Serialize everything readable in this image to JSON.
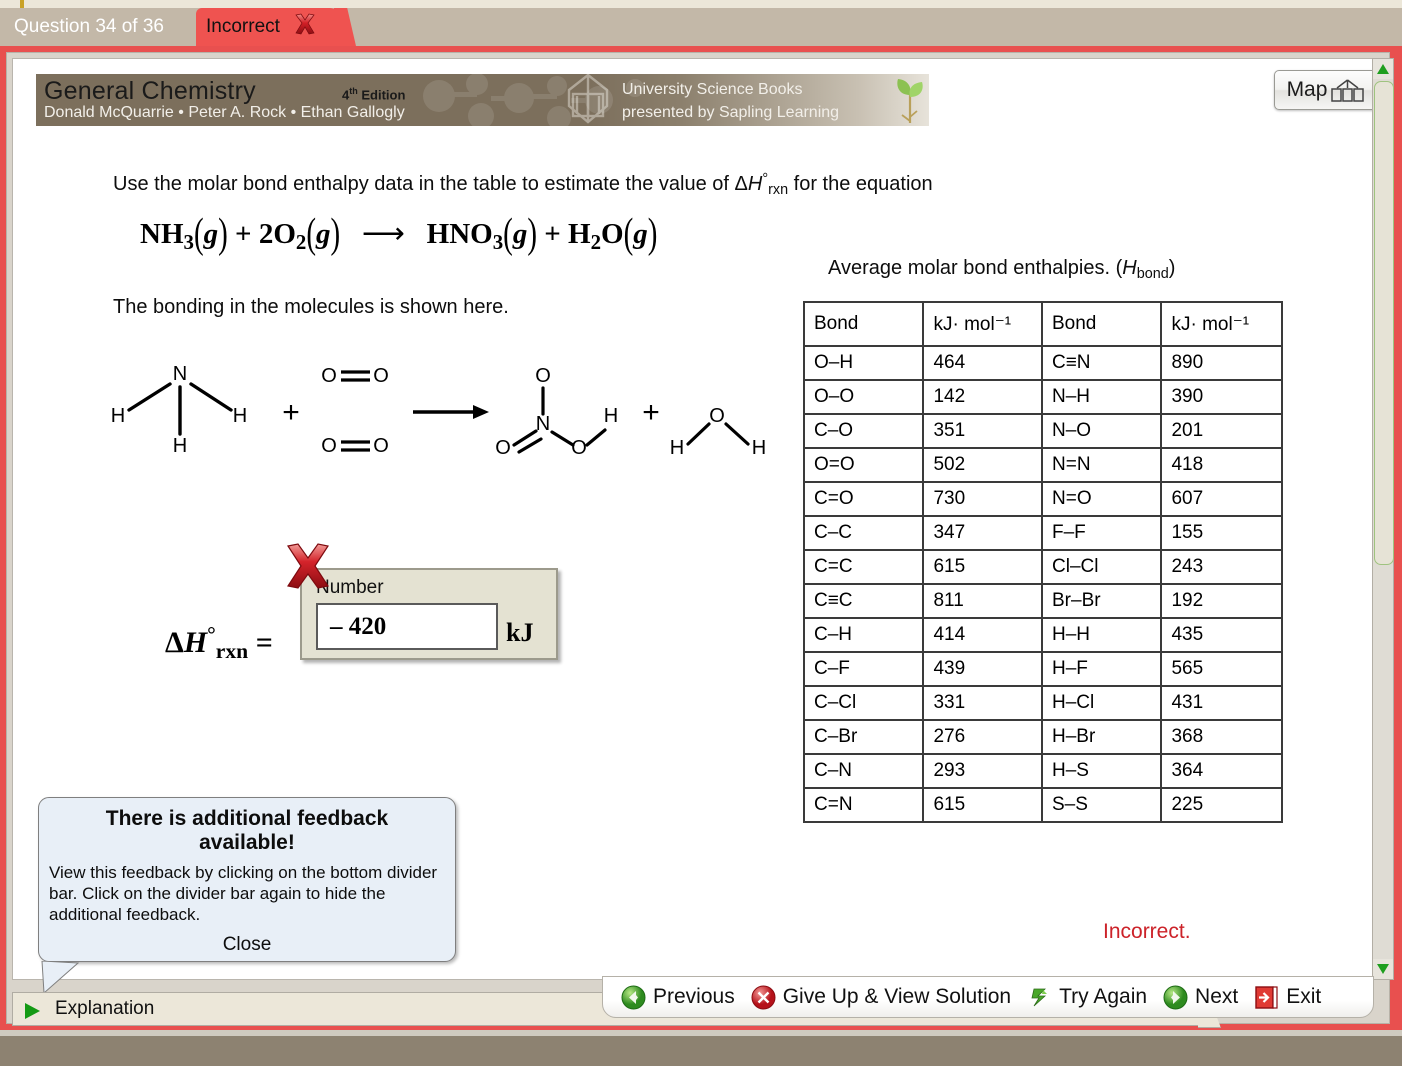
{
  "tabs": {
    "question_label": "Question 34 of 36",
    "status_label": "Incorrect",
    "status_icon": "red-x-icon"
  },
  "banner": {
    "title": "General Chemistry",
    "edition": "4th Edition",
    "edition_sup": "th",
    "edition_prefix": "4",
    "edition_suffix": " Edition",
    "authors": "Donald McQuarrie • Peter A. Rock • Ethan Gallogly",
    "publisher": "University Science Books",
    "presenter": "presented by Sapling Learning"
  },
  "map_button": {
    "label": "Map",
    "icon": "map-icon"
  },
  "question": {
    "prompt_part1": "Use the molar bond enthalpy data in the table to estimate the value of ",
    "prompt_symbol_delta": "Δ",
    "prompt_symbol_H": "H",
    "prompt_symbol_deg": "°",
    "prompt_symbol_rxn": "rxn",
    "prompt_part2": " for the equation",
    "equation_reactants": "NH3(g) + 2O2(g)",
    "equation_products": "HNO3(g) + H2O(g)",
    "equation_arrow": "⟶",
    "bonding_text": "The bonding in the molecules is shown here."
  },
  "equation_parts": {
    "r1_formula": "NH",
    "r1_sub": "3",
    "r1_state": "g",
    "r2_coef": "2",
    "r2_formula": "O",
    "r2_sub": "2",
    "r2_state": "g",
    "p1_formula": "HNO",
    "p1_sub": "3",
    "p1_state": "g",
    "p2_formula": "H",
    "p2_sub": "2",
    "p2_formula2": "O",
    "p2_state": "g",
    "plus": "+"
  },
  "molecule_diagram": {
    "ammonia_labels": [
      "N",
      "H",
      "H",
      "H"
    ],
    "oxygen_labels": [
      "O",
      "O"
    ],
    "nitric_acid_labels": [
      "O",
      "N",
      "O",
      "O",
      "H"
    ],
    "water_labels": [
      "O",
      "H",
      "H"
    ],
    "plus1": "+",
    "plus2": "+",
    "arrow": "→"
  },
  "table": {
    "caption_main": "Average molar bond enthalpies. (",
    "caption_H": "H",
    "caption_sub": "bond",
    "caption_end": ")",
    "headers": [
      "Bond",
      "kJ· mol⁻¹",
      "Bond",
      "kJ· mol⁻¹"
    ],
    "rows": [
      [
        "O–H",
        "464",
        "C≡N",
        "890"
      ],
      [
        "O–O",
        "142",
        "N–H",
        "390"
      ],
      [
        "C–O",
        "351",
        "N–O",
        "201"
      ],
      [
        "O=O",
        "502",
        "N=N",
        "418"
      ],
      [
        "C=O",
        "730",
        "N=O",
        "607"
      ],
      [
        "C–C",
        "347",
        "F–F",
        "155"
      ],
      [
        "C=C",
        "615",
        "Cl–Cl",
        "243"
      ],
      [
        "C≡C",
        "811",
        "Br–Br",
        "192"
      ],
      [
        "C–H",
        "414",
        "H–H",
        "435"
      ],
      [
        "C–F",
        "439",
        "H–F",
        "565"
      ],
      [
        "C–Cl",
        "331",
        "H–Cl",
        "431"
      ],
      [
        "C–Br",
        "276",
        "H–Br",
        "368"
      ],
      [
        "C–N",
        "293",
        "H–S",
        "364"
      ],
      [
        "C=N",
        "615",
        "S–S",
        "225"
      ]
    ]
  },
  "answer": {
    "dh_delta": "Δ",
    "dh_H": "H",
    "dh_deg": "°",
    "dh_sub": "rxn",
    "equals": "=",
    "field_label": "Number",
    "value": "– 420",
    "unit": "kJ",
    "mark_icon": "red-x-icon"
  },
  "callout": {
    "title": "There is additional feedback available!",
    "body": "View this feedback by clicking on the bottom divider bar. Click on the divider bar again to hide the additional feedback.",
    "close_label": "Close"
  },
  "status_message": "Incorrect.",
  "explanation_bar": {
    "label": "Explanation",
    "icon": "play-triangle-icon"
  },
  "nav": {
    "items": [
      {
        "label": "Previous",
        "icon": "green-back-arrow-icon"
      },
      {
        "label": "Give Up & View Solution",
        "icon": "red-x-circle-icon"
      },
      {
        "label": "Try Again",
        "icon": "green-refresh-icon"
      },
      {
        "label": "Next",
        "icon": "green-forward-arrow-icon"
      },
      {
        "label": "Exit",
        "icon": "red-exit-door-icon"
      }
    ]
  },
  "colors": {
    "incorrect_red": "#cc2229",
    "tab_red": "#ef5350",
    "banner_brown": "#7c6f5c",
    "panel_beige": "#ece7d9"
  }
}
